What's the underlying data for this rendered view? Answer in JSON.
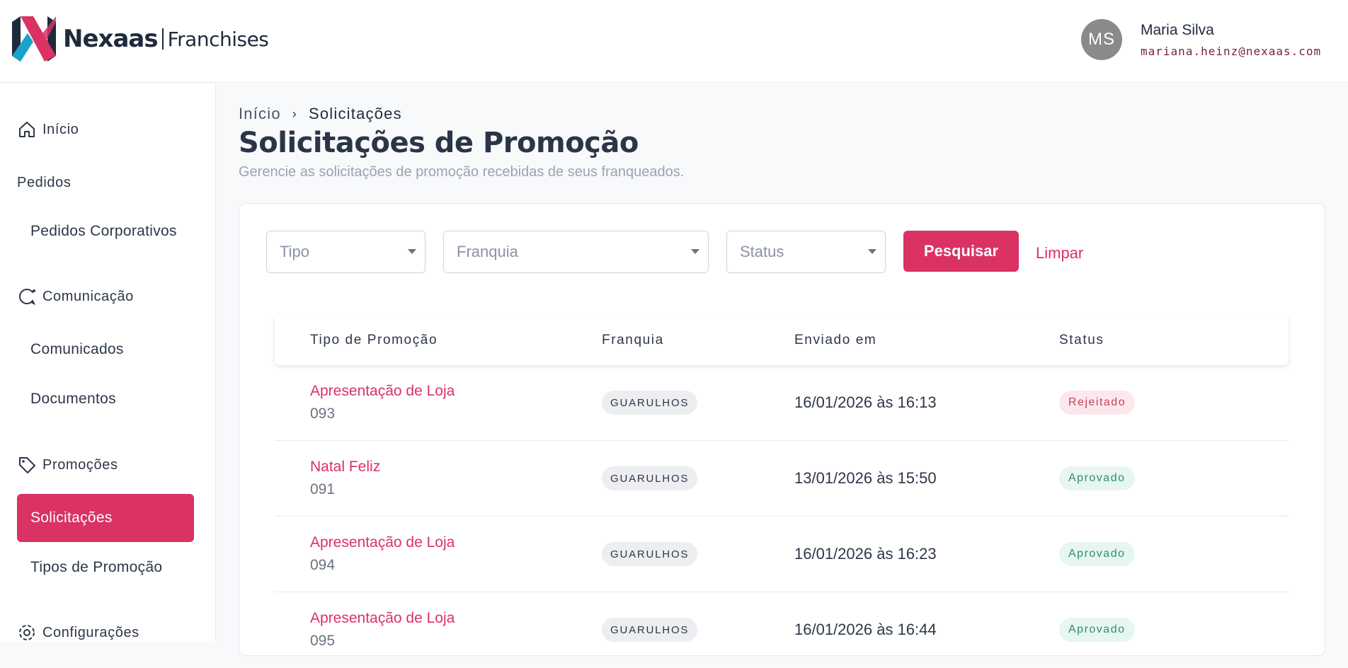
{
  "brand": {
    "name": "Nexaas",
    "product": "Franchises",
    "accent": "#d93263"
  },
  "user": {
    "initials": "MS",
    "name": "Maria Silva",
    "email": "mariana.heinz@nexaas.com"
  },
  "sidebar": {
    "inicio": "Início",
    "pedidos": "Pedidos",
    "pedidos_corporativos": "Pedidos Corporativos",
    "comunicacao": "Comunicação",
    "comunicados": "Comunicados",
    "documentos": "Documentos",
    "promocoes": "Promoções",
    "solicitacoes": "Solicitações",
    "tipos_promocao": "Tipos de Promoção",
    "configuracoes": "Configurações"
  },
  "breadcrumb": {
    "home": "Início",
    "current": "Solicitações"
  },
  "page": {
    "title": "Solicitações de Promoção",
    "subtitle": "Gerencie as solicitações de promoção recebidas de seus franqueados."
  },
  "filters": {
    "tipo": "Tipo",
    "franquia": "Franquia",
    "status": "Status",
    "search_label": "Pesquisar",
    "clear_label": "Limpar"
  },
  "table": {
    "headers": [
      "Tipo de Promoção",
      "Franquia",
      "Enviado em",
      "Status"
    ],
    "rows": [
      {
        "name": "Apresentação de Loja",
        "number": "093",
        "franchise": "GUARULHOS",
        "sent": "16/01/2026 às 16:13",
        "status": "Rejeitado"
      },
      {
        "name": "Natal Feliz",
        "number": "091",
        "franchise": "GUARULHOS",
        "sent": "13/01/2026 às 15:50",
        "status": "Aprovado"
      },
      {
        "name": "Apresentação de Loja",
        "number": "094",
        "franchise": "GUARULHOS",
        "sent": "16/01/2026 às 16:23",
        "status": "Aprovado"
      },
      {
        "name": "Apresentação de Loja",
        "number": "095",
        "franchise": "GUARULHOS",
        "sent": "16/01/2026 às 16:44",
        "status": "Aprovado"
      }
    ]
  }
}
